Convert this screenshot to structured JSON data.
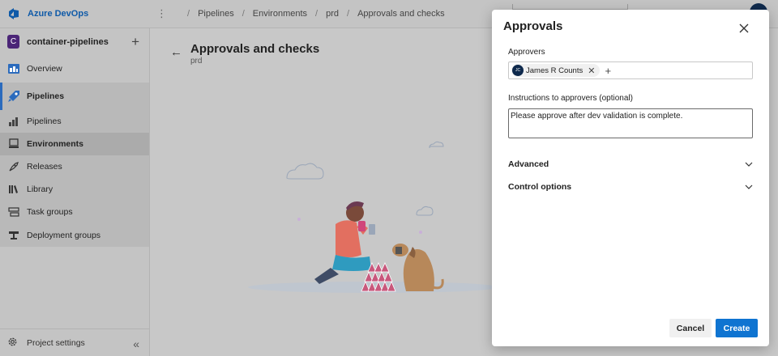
{
  "app": {
    "name": "Azure DevOps"
  },
  "breadcrumbs": [
    "Pipelines",
    "Environments",
    "prd",
    "Approvals and checks"
  ],
  "sidebar": {
    "project": {
      "initial": "C",
      "name": "container-pipelines"
    },
    "items": [
      {
        "label": "Overview",
        "icon": "overview-icon"
      },
      {
        "label": "Pipelines",
        "icon": "pipelines-icon"
      },
      {
        "label": "Pipelines",
        "icon": "pipelines-sub-icon"
      },
      {
        "label": "Environments",
        "icon": "environments-icon"
      },
      {
        "label": "Releases",
        "icon": "releases-icon"
      },
      {
        "label": "Library",
        "icon": "library-icon"
      },
      {
        "label": "Task groups",
        "icon": "task-groups-icon"
      },
      {
        "label": "Deployment groups",
        "icon": "deployment-groups-icon"
      }
    ],
    "footer": "Project settings"
  },
  "page": {
    "title": "Approvals and checks",
    "subtitle": "prd"
  },
  "dialog": {
    "title": "Approvals",
    "approvers_label": "Approvers",
    "approver": {
      "initials": "JC",
      "name": "James R Counts"
    },
    "instructions_label": "Instructions to approvers (optional)",
    "instructions_value": "Please approve after dev validation is complete.",
    "advanced": "Advanced",
    "control_options": "Control options",
    "cancel": "Cancel",
    "create": "Create"
  },
  "colors": {
    "brand": "#0f5aa8",
    "primary_button": "#0f74d1",
    "project_badge": "#4b2577",
    "selection_accent": "#2b6bbd"
  }
}
